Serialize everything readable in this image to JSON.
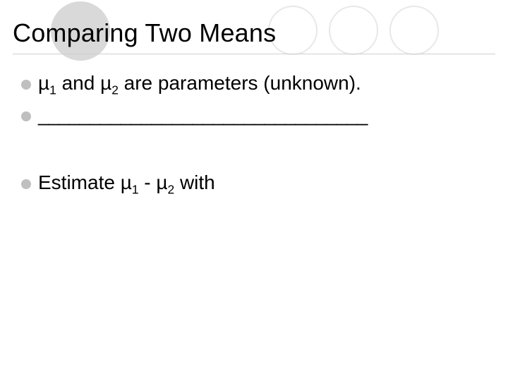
{
  "title": "Comparing Two Means",
  "bullets": {
    "b1": {
      "pre": "µ",
      "sub1": "1",
      "mid": " and µ",
      "sub2": "2",
      "post": " are parameters (unknown)."
    },
    "b2": {
      "text": "________________________________"
    },
    "b3": {
      "pre": "Estimate µ",
      "sub1": "1",
      "mid": " - µ",
      "sub2": "2",
      "post": " with"
    }
  }
}
